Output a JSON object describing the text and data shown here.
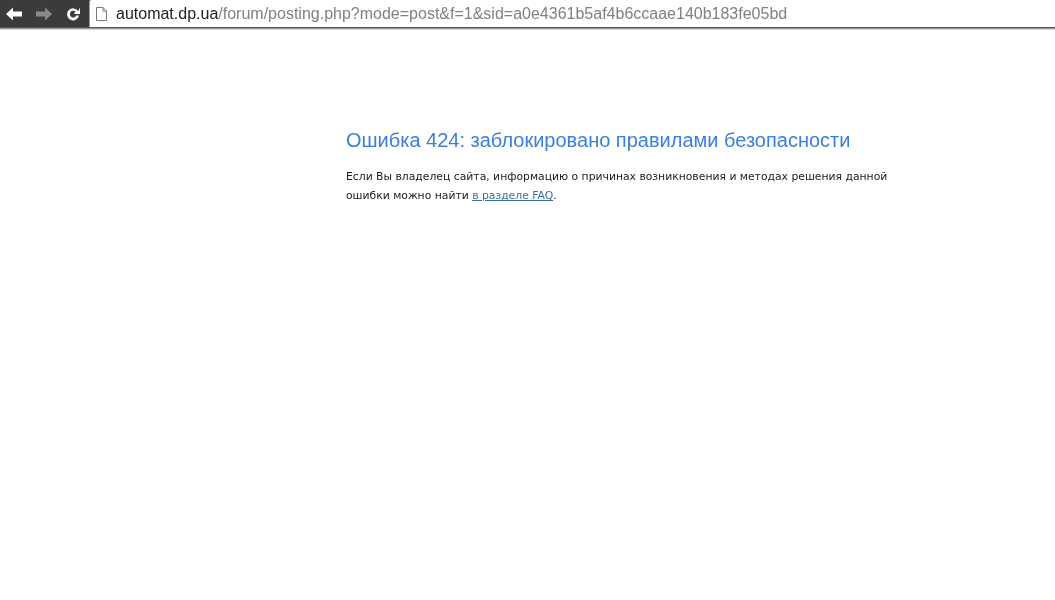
{
  "browser": {
    "back": {
      "disabled": false
    },
    "forward": {
      "disabled": true
    },
    "url": {
      "host": "automat.dp.ua",
      "path": "/forum/posting.php?mode=post&f=1&sid=a0e4361b5af4b6ccaae140b183fe05bd"
    }
  },
  "page": {
    "title": "Ошибка 424: заблокировано правилами безопасности",
    "message": {
      "text": "Если Вы владелец сайта, информацию о причинах возникновения и методах решения данной ошибки можно найти ",
      "link": "в разделе FAQ",
      "end": "."
    }
  }
}
